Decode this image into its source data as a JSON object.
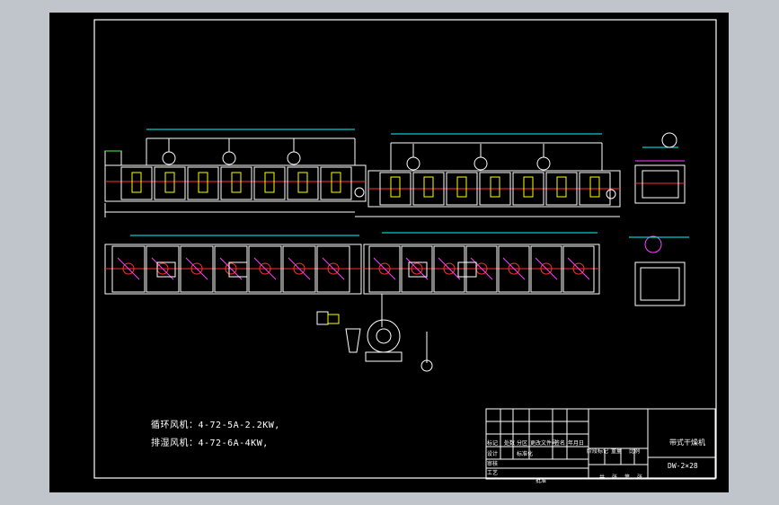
{
  "notes": {
    "circulating_fan": "循环风机：4-72-5A-2.2KW,",
    "exhaust_fan": "排湿风机：4-72-6A-4KW,"
  },
  "title_block": {
    "drawing_name": "带式干燥机",
    "drawing_number": "DW-2×28",
    "cells": [
      "标记",
      "处数",
      "分区",
      "更改文件号",
      "签名",
      "年月日",
      "设计",
      "标准化",
      "阶段标记",
      "重量",
      "比例",
      "审核",
      "工艺",
      "批准",
      "共",
      "张",
      "第",
      "张"
    ]
  },
  "colors": {
    "background": "#000000",
    "outline": "#ffffff",
    "dimension": "#00ffff",
    "accent_red": "#ff3030",
    "accent_yellow": "#ffff00",
    "accent_magenta": "#ff40ff",
    "accent_green": "#40ff40",
    "accent_blue": "#4060ff"
  }
}
